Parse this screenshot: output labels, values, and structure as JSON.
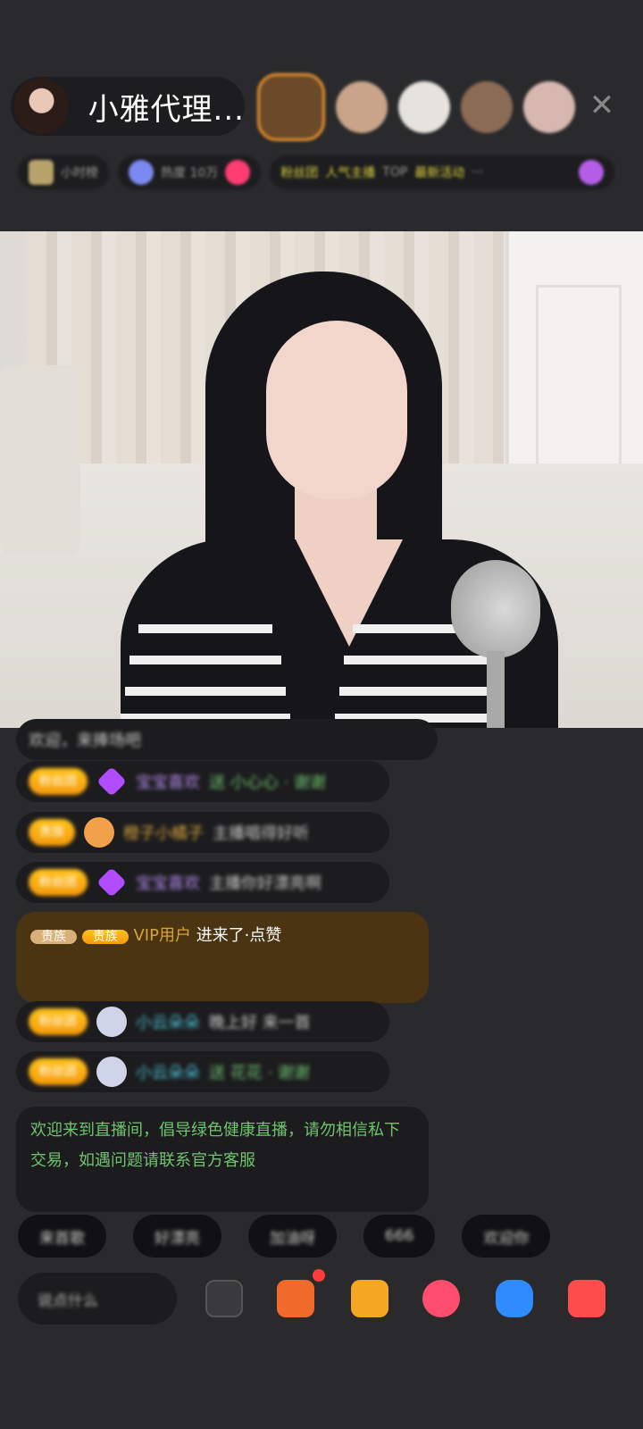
{
  "header": {
    "host_name": "小雅代理...",
    "close_icon": "close-icon",
    "viewer_avatar_colors": [
      "#6b4a2a",
      "#c9a48a",
      "#e6e2dd",
      "#8b6b55",
      "#d6b8b0"
    ]
  },
  "info_bar": {
    "chip1": "小时榜",
    "chip2": "热度 10万",
    "chip3_items": [
      "粉丝团",
      "人气主播",
      "TOP",
      "最新活动"
    ],
    "chip4": "···"
  },
  "chat": {
    "messages": [
      {
        "badge": "",
        "user": "",
        "text": "欢迎，来捧场吧"
      },
      {
        "badge": "粉丝团",
        "user": "宝宝喜欢",
        "text": "送 小心心 · 谢谢"
      },
      {
        "badge": "贵族",
        "user": "橙子小橘子",
        "text": "主播唱得好听"
      },
      {
        "badge": "粉丝团",
        "user": "宝宝喜欢",
        "text": "主播你好漂亮啊"
      },
      {
        "badge": "贵族",
        "user": "VIP用户",
        "text": "进来了·点赞"
      },
      {
        "badge": "粉丝团",
        "user": "小云朵朵",
        "text": "晚上好 来一首"
      },
      {
        "badge": "粉丝团",
        "user": "小云朵朵",
        "text": "送 花花 · 谢谢"
      }
    ],
    "system_notice": "欢迎来到直播间，倡导绿色健康直播，请勿相信私下交易，如遇问题请联系官方客服"
  },
  "quick_replies": [
    "来首歌",
    "好漂亮",
    "加油呀",
    "666",
    "欢迎你"
  ],
  "bottom_bar": {
    "say_placeholder": "说点什么",
    "icons": [
      "chat-icon",
      "gift-box-icon",
      "gift-icon",
      "heart-icon",
      "game-icon",
      "more-icon"
    ],
    "colors": {
      "gift_box": "#f06a2b",
      "gift": "#f5a623",
      "heart": "#ff4d6d",
      "game": "#2f8cff",
      "more": "#ff4d4d"
    }
  }
}
